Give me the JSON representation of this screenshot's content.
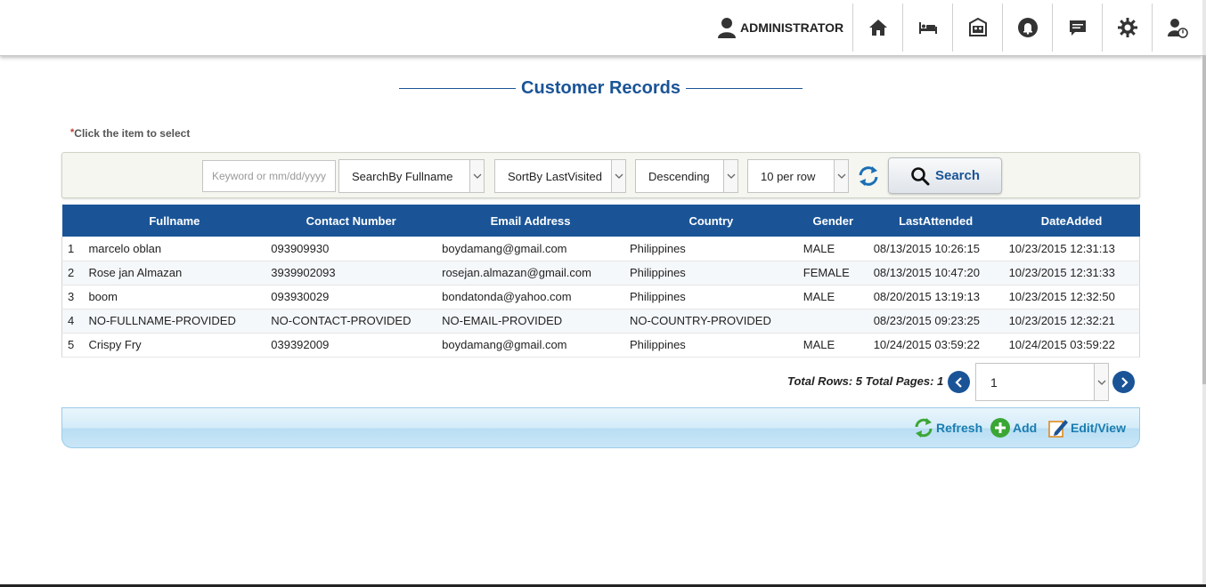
{
  "header": {
    "user_label": "ADMINISTRATOR",
    "nav_icons": [
      "home-icon",
      "bed-icon",
      "contact-card-icon",
      "bell-icon",
      "chat-icon",
      "gear-icon",
      "user-logout-icon"
    ]
  },
  "page": {
    "title": "Customer Records",
    "hint_star": "*",
    "hint": "Click the item to select"
  },
  "filters": {
    "keyword_placeholder": "Keyword or mm/dd/yyyy",
    "search_by": "SearchBy Fullname",
    "sort_by": "SortBy LastVisited",
    "order": "Descending",
    "per_row": "10 per row",
    "search_label": "Search"
  },
  "table": {
    "columns": [
      "Fullname",
      "Contact Number",
      "Email Address",
      "Country",
      "Gender",
      "LastAttended",
      "DateAdded"
    ],
    "rows": [
      {
        "num": "1",
        "fullname": "marcelo oblan",
        "contact": "093909930",
        "email": "boydamang@gmail.com",
        "country": "Philippines",
        "gender": "MALE",
        "last": "08/13/2015 10:26:15",
        "added": "10/23/2015 12:31:13"
      },
      {
        "num": "2",
        "fullname": "Rose jan Almazan",
        "contact": "3939902093",
        "email": "rosejan.almazan@gmail.com",
        "country": "Philippines",
        "gender": "FEMALE",
        "last": "08/13/2015 10:47:20",
        "added": "10/23/2015 12:31:33"
      },
      {
        "num": "3",
        "fullname": "boom",
        "contact": "093930029",
        "email": "bondatonda@yahoo.com",
        "country": "Philippines",
        "gender": "MALE",
        "last": "08/20/2015 13:19:13",
        "added": "10/23/2015 12:32:50"
      },
      {
        "num": "4",
        "fullname": "NO-FULLNAME-PROVIDED",
        "contact": "NO-CONTACT-PROVIDED",
        "email": "NO-EMAIL-PROVIDED",
        "country": "NO-COUNTRY-PROVIDED",
        "gender": "",
        "last": "08/23/2015 09:23:25",
        "added": "10/23/2015 12:32:21"
      },
      {
        "num": "5",
        "fullname": "Crispy Fry",
        "contact": "039392009",
        "email": "boydamang@gmail.com",
        "country": "Philippines",
        "gender": "MALE",
        "last": "10/24/2015 03:59:22",
        "added": "10/24/2015 03:59:22"
      }
    ]
  },
  "pager": {
    "info": "Total Rows: 5 Total Pages: 1",
    "page": "1"
  },
  "actions": {
    "refresh": "Refresh",
    "add": "Add",
    "edit": "Edit/View"
  },
  "colors": {
    "brand_blue": "#1a5497",
    "action_blue": "#1a7db0",
    "add_green": "#3aa635"
  }
}
